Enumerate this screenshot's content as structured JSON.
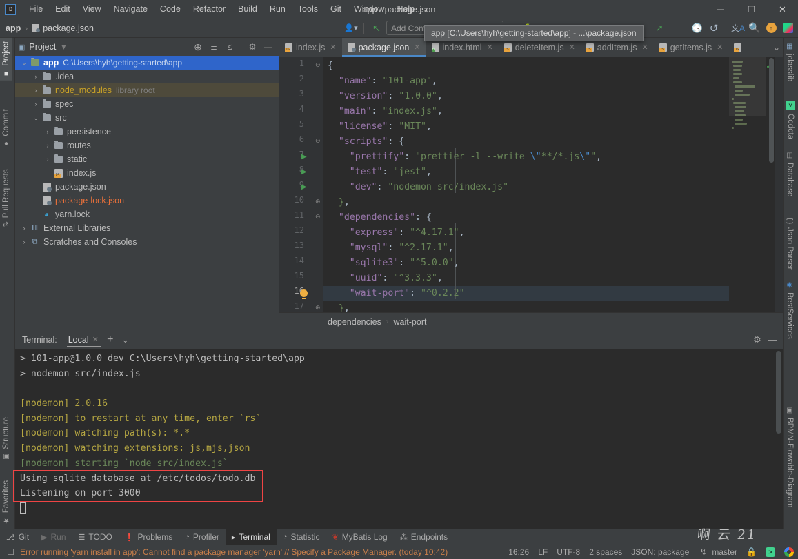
{
  "window": {
    "title": "app - package.json",
    "minimize": "─",
    "maximize": "☐",
    "close": "✕"
  },
  "menu": {
    "items": [
      "File",
      "Edit",
      "View",
      "Navigate",
      "Code",
      "Refactor",
      "Build",
      "Run",
      "Tools",
      "Git",
      "Window",
      "Help"
    ]
  },
  "toolbar": {
    "breadcrumb_project": "app",
    "breadcrumb_sep": "›",
    "breadcrumb_file": "package.json",
    "run_config_placeholder": "Add Configuration...",
    "tooltip": "app [C:\\Users\\hyh\\getting-started\\app] - ...\\package.json",
    "icons": [
      "user-avatar-icon",
      "vcs-update-icon",
      "run-icon",
      "debug-icon",
      "stop-icon",
      "coverage-icon",
      "profile-icon",
      "build-icon",
      "search-everywhere-icon",
      "recent-files-icon",
      "undo-icon",
      "translate-icon",
      "search-icon",
      "update-available-icon",
      "jetbrains-toolbox-icon"
    ]
  },
  "left_stripe": {
    "items": [
      {
        "label": "Project",
        "icon": "project-icon",
        "selected": true
      },
      {
        "label": "Commit",
        "icon": "commit-icon",
        "selected": false
      },
      {
        "label": "Pull Requests",
        "icon": "pull-request-icon",
        "selected": false
      }
    ],
    "bottom_items": [
      {
        "label": "Structure",
        "icon": "structure-icon"
      },
      {
        "label": "Favorites",
        "icon": "star-icon"
      }
    ]
  },
  "right_stripe": {
    "items": [
      {
        "label": "jclasslib",
        "icon": "jclasslib-icon"
      },
      {
        "label": "Codota",
        "icon": "codota-icon"
      },
      {
        "label": "Database",
        "icon": "database-icon"
      },
      {
        "label": "Json Parser",
        "icon": "json-parser-icon"
      },
      {
        "label": "RestServices",
        "icon": "rest-services-icon"
      }
    ],
    "bottom_items": [
      {
        "label": "BPMN-Flowable-Diagram",
        "icon": "bpmn-diagram-icon"
      }
    ]
  },
  "project_panel": {
    "title": "Project",
    "dropdown": "▾",
    "tool_icons": [
      "locate-icon",
      "expand-all-icon",
      "collapse-all-icon",
      "settings-gear-icon",
      "hide-icon"
    ],
    "tree": [
      {
        "depth": 0,
        "arrow": "⌄",
        "icon": "module-icon",
        "label": "app",
        "suffix": "C:\\Users\\hyh\\getting-started\\app",
        "state": "selected",
        "bold": true
      },
      {
        "depth": 1,
        "arrow": "›",
        "icon": "folder-icon",
        "label": ".idea",
        "suffix": "",
        "state": "normal"
      },
      {
        "depth": 1,
        "arrow": "›",
        "icon": "folder-icon",
        "label": "node_modules",
        "suffix": "library root",
        "state": "highlighted",
        "color": "yellow"
      },
      {
        "depth": 1,
        "arrow": "›",
        "icon": "folder-icon",
        "label": "spec",
        "suffix": "",
        "state": "normal"
      },
      {
        "depth": 1,
        "arrow": "⌄",
        "icon": "folder-icon",
        "label": "src",
        "suffix": "",
        "state": "normal"
      },
      {
        "depth": 2,
        "arrow": "›",
        "icon": "folder-icon",
        "label": "persistence",
        "suffix": "",
        "state": "normal"
      },
      {
        "depth": 2,
        "arrow": "›",
        "icon": "folder-icon",
        "label": "routes",
        "suffix": "",
        "state": "normal"
      },
      {
        "depth": 2,
        "arrow": "›",
        "icon": "folder-icon",
        "label": "static",
        "suffix": "",
        "state": "normal"
      },
      {
        "depth": 2,
        "arrow": "",
        "icon": "js-file-icon",
        "label": "index.js",
        "suffix": "",
        "state": "normal"
      },
      {
        "depth": 1,
        "arrow": "",
        "icon": "package-json-icon",
        "label": "package.json",
        "suffix": "",
        "state": "normal"
      },
      {
        "depth": 1,
        "arrow": "",
        "icon": "package-json-icon",
        "label": "package-lock.json",
        "suffix": "",
        "state": "normal",
        "color": "orange"
      },
      {
        "depth": 1,
        "arrow": "",
        "icon": "yarn-lock-icon",
        "label": "yarn.lock",
        "suffix": "",
        "state": "normal"
      },
      {
        "depth": 0,
        "arrow": "›",
        "icon": "external-libraries-icon",
        "label": "External Libraries",
        "suffix": "",
        "state": "normal"
      },
      {
        "depth": 0,
        "arrow": "›",
        "icon": "scratches-icon",
        "label": "Scratches and Consoles",
        "suffix": "",
        "state": "normal"
      }
    ]
  },
  "editor": {
    "tabs": [
      {
        "label": "index.js",
        "icon": "js-file-icon",
        "active": false
      },
      {
        "label": "package.json",
        "icon": "package-json-icon",
        "active": true
      },
      {
        "label": "index.html",
        "icon": "html-file-icon",
        "active": false
      },
      {
        "label": "deleteItem.js",
        "icon": "js-file-icon",
        "active": false
      },
      {
        "label": "addItem.js",
        "icon": "js-file-icon",
        "active": false
      },
      {
        "label": "getItems.js",
        "icon": "js-file-icon",
        "active": false
      },
      {
        "label": "",
        "icon": "js-file-icon",
        "active": false
      }
    ],
    "tabs_overflow": "⌄",
    "current_line": 16,
    "inspection_status": "ok",
    "lines": [
      {
        "n": 1,
        "indent": 0,
        "tokens": [
          {
            "t": "{",
            "c": "brc"
          }
        ],
        "fold": "⊖"
      },
      {
        "n": 2,
        "indent": 2,
        "tokens": [
          {
            "t": "\"name\"",
            "c": "key"
          },
          {
            "t": ": ",
            "c": "brc"
          },
          {
            "t": "\"101-app\"",
            "c": "str"
          },
          {
            "t": ",",
            "c": "brc"
          }
        ]
      },
      {
        "n": 3,
        "indent": 2,
        "tokens": [
          {
            "t": "\"version\"",
            "c": "key"
          },
          {
            "t": ": ",
            "c": "brc"
          },
          {
            "t": "\"1.0.0\"",
            "c": "str"
          },
          {
            "t": ",",
            "c": "brc"
          }
        ]
      },
      {
        "n": 4,
        "indent": 2,
        "tokens": [
          {
            "t": "\"main\"",
            "c": "key"
          },
          {
            "t": ": ",
            "c": "brc"
          },
          {
            "t": "\"index.js\"",
            "c": "str"
          },
          {
            "t": ",",
            "c": "brc"
          }
        ]
      },
      {
        "n": 5,
        "indent": 2,
        "tokens": [
          {
            "t": "\"license\"",
            "c": "key"
          },
          {
            "t": ": ",
            "c": "brc"
          },
          {
            "t": "\"MIT\"",
            "c": "str"
          },
          {
            "t": ",",
            "c": "brc"
          }
        ]
      },
      {
        "n": 6,
        "indent": 2,
        "tokens": [
          {
            "t": "\"scripts\"",
            "c": "key"
          },
          {
            "t": ": ",
            "c": "brc"
          },
          {
            "t": "{",
            "c": "brc"
          }
        ],
        "fold": "⊖"
      },
      {
        "n": 7,
        "indent": 4,
        "run": true,
        "tokens": [
          {
            "t": "\"prettify\"",
            "c": "key"
          },
          {
            "t": ": ",
            "c": "brc"
          },
          {
            "t": "\"prettier -l --write ",
            "c": "str"
          },
          {
            "t": "\\\"",
            "c": "esc"
          },
          {
            "t": "**/*.js",
            "c": "str"
          },
          {
            "t": "\\\"",
            "c": "esc"
          },
          {
            "t": "\"",
            "c": "str"
          },
          {
            "t": ",",
            "c": "brc"
          }
        ]
      },
      {
        "n": 8,
        "indent": 4,
        "run": true,
        "tokens": [
          {
            "t": "\"test\"",
            "c": "key"
          },
          {
            "t": ": ",
            "c": "brc"
          },
          {
            "t": "\"jest\"",
            "c": "str"
          },
          {
            "t": ",",
            "c": "brc"
          }
        ]
      },
      {
        "n": 9,
        "indent": 4,
        "run": true,
        "tokens": [
          {
            "t": "\"dev\"",
            "c": "key"
          },
          {
            "t": ": ",
            "c": "brc"
          },
          {
            "t": "\"nodemon src/index.js\"",
            "c": "str"
          }
        ]
      },
      {
        "n": 10,
        "indent": 2,
        "tokens": [
          {
            "t": "}",
            "c": "str"
          },
          {
            "t": ",",
            "c": "brc"
          }
        ],
        "fold": "⊕"
      },
      {
        "n": 11,
        "indent": 2,
        "tokens": [
          {
            "t": "\"dependencies\"",
            "c": "key"
          },
          {
            "t": ": ",
            "c": "brc"
          },
          {
            "t": "{",
            "c": "brc"
          }
        ],
        "fold": "⊖"
      },
      {
        "n": 12,
        "indent": 4,
        "tokens": [
          {
            "t": "\"express\"",
            "c": "key"
          },
          {
            "t": ": ",
            "c": "brc"
          },
          {
            "t": "\"^4.17.1\"",
            "c": "str"
          },
          {
            "t": ",",
            "c": "brc"
          }
        ]
      },
      {
        "n": 13,
        "indent": 4,
        "tokens": [
          {
            "t": "\"mysql\"",
            "c": "key"
          },
          {
            "t": ": ",
            "c": "brc"
          },
          {
            "t": "\"^2.17.1\"",
            "c": "str"
          },
          {
            "t": ",",
            "c": "brc"
          }
        ]
      },
      {
        "n": 14,
        "indent": 4,
        "tokens": [
          {
            "t": "\"sqlite3\"",
            "c": "key"
          },
          {
            "t": ": ",
            "c": "brc"
          },
          {
            "t": "\"^5.0.0\"",
            "c": "str"
          },
          {
            "t": ",",
            "c": "brc"
          }
        ]
      },
      {
        "n": 15,
        "indent": 4,
        "tokens": [
          {
            "t": "\"uuid\"",
            "c": "key"
          },
          {
            "t": ": ",
            "c": "brc"
          },
          {
            "t": "\"^3.3.3\"",
            "c": "str"
          },
          {
            "t": ",",
            "c": "brc"
          }
        ]
      },
      {
        "n": 16,
        "indent": 4,
        "bulb": true,
        "tokens": [
          {
            "t": "\"wait-port\"",
            "c": "key"
          },
          {
            "t": ": ",
            "c": "brc"
          },
          {
            "t": "\"^0.2.2\"",
            "c": "str"
          }
        ]
      },
      {
        "n": 17,
        "indent": 2,
        "tokens": [
          {
            "t": "}",
            "c": "str"
          },
          {
            "t": ",",
            "c": "brc"
          }
        ],
        "fold": "⊕"
      }
    ],
    "breadcrumbs": [
      "dependencies",
      "wait-port"
    ],
    "breadcrumb_sep": "›"
  },
  "terminal": {
    "label": "Terminal:",
    "tab": "Local",
    "tab_close": "✕",
    "add": "+",
    "dropdown": "⌄",
    "settings_icon": "settings-gear-icon",
    "hide_icon": "hide-icon",
    "lines": [
      {
        "text": "> 101-app@1.0.0 dev C:\\Users\\hyh\\getting-started\\app",
        "color": "white"
      },
      {
        "text": "> nodemon src/index.js",
        "color": "white"
      },
      {
        "text": "",
        "color": "white"
      },
      {
        "text": "[nodemon] 2.0.16",
        "color": "yellow"
      },
      {
        "text": "[nodemon] to restart at any time, enter `rs`",
        "color": "yellow"
      },
      {
        "text": "[nodemon] watching path(s): *.*",
        "color": "yellow"
      },
      {
        "text": "[nodemon] watching extensions: js,mjs,json",
        "color": "yellow"
      },
      {
        "text": "[nodemon] starting `node src/index.js`",
        "color": "green"
      },
      {
        "text": "Using sqlite database at /etc/todos/todo.db",
        "color": "white"
      },
      {
        "text": "Listening on port 3000",
        "color": "white"
      }
    ],
    "highlight_color": "#ef4444"
  },
  "tool_window_bar": {
    "items": [
      {
        "label": "Git",
        "icon": "git-branch-icon",
        "selected": false,
        "dim": false
      },
      {
        "label": "Run",
        "icon": "run-icon",
        "selected": false,
        "dim": true
      },
      {
        "label": "TODO",
        "icon": "todo-list-icon",
        "selected": false,
        "dim": false
      },
      {
        "label": "Problems",
        "icon": "problems-icon",
        "selected": false,
        "dim": false
      },
      {
        "label": "Profiler",
        "icon": "profiler-icon",
        "selected": false,
        "dim": false
      },
      {
        "label": "Terminal",
        "icon": "terminal-icon",
        "selected": true,
        "dim": false
      },
      {
        "label": "Statistic",
        "icon": "statistic-icon",
        "selected": false,
        "dim": false
      },
      {
        "label": "MyBatis Log",
        "icon": "mybatis-icon",
        "selected": false,
        "dim": false
      },
      {
        "label": "Endpoints",
        "icon": "endpoints-icon",
        "selected": false,
        "dim": false
      }
    ]
  },
  "status_bar": {
    "message": "Error running 'yarn install in app': Cannot find a package manager 'yarn' // Specify a Package Manager. (today 10:42)",
    "message_icon": "notification-icon",
    "time": "16:26",
    "line_separator": "LF",
    "encoding": "UTF-8",
    "indent": "2 spaces",
    "file_type": "JSON: package",
    "branch": "master",
    "branch_icon": "git-branch-icon",
    "lock_icon": "lock-icon",
    "codota_icon": "codota-icon",
    "chrome_icon": "chrome-icon",
    "watermark": "啊 云 21"
  }
}
